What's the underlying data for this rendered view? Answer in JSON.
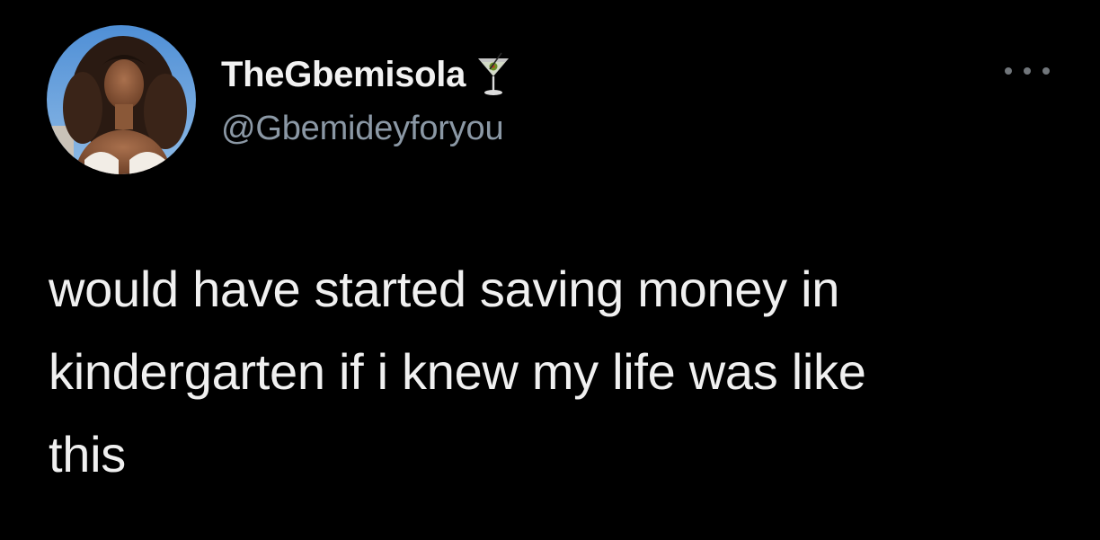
{
  "tweet": {
    "author": {
      "display_name": "TheGbemisola",
      "handle": "@Gbemideyforyou",
      "name_emoji": "cocktail-glass"
    },
    "text_lines": [
      "would have started saving money in",
      "kindergarten if i knew my life was like",
      "this"
    ],
    "colors": {
      "background": "#000000",
      "primary_text": "#f0f0f0",
      "secondary_text": "#8b98a5"
    }
  }
}
